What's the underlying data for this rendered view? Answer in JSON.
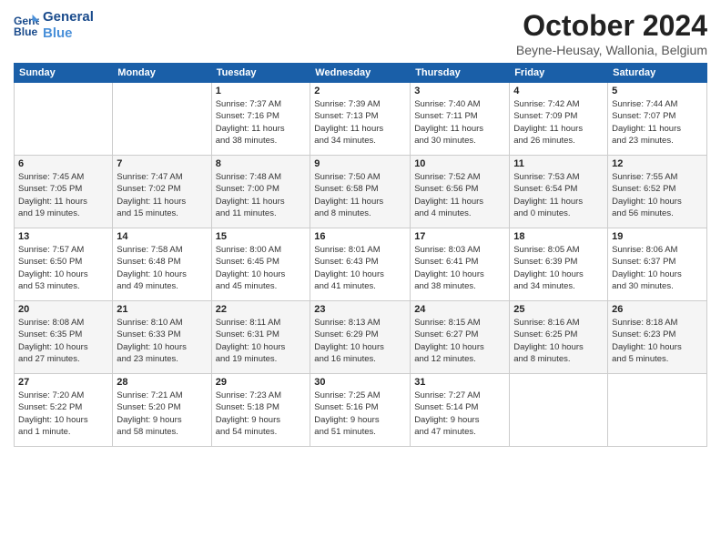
{
  "logo": {
    "line1": "General",
    "line2": "Blue"
  },
  "title": "October 2024",
  "subtitle": "Beyne-Heusay, Wallonia, Belgium",
  "days_of_week": [
    "Sunday",
    "Monday",
    "Tuesday",
    "Wednesday",
    "Thursday",
    "Friday",
    "Saturday"
  ],
  "weeks": [
    [
      {
        "num": "",
        "detail": ""
      },
      {
        "num": "",
        "detail": ""
      },
      {
        "num": "1",
        "detail": "Sunrise: 7:37 AM\nSunset: 7:16 PM\nDaylight: 11 hours\nand 38 minutes."
      },
      {
        "num": "2",
        "detail": "Sunrise: 7:39 AM\nSunset: 7:13 PM\nDaylight: 11 hours\nand 34 minutes."
      },
      {
        "num": "3",
        "detail": "Sunrise: 7:40 AM\nSunset: 7:11 PM\nDaylight: 11 hours\nand 30 minutes."
      },
      {
        "num": "4",
        "detail": "Sunrise: 7:42 AM\nSunset: 7:09 PM\nDaylight: 11 hours\nand 26 minutes."
      },
      {
        "num": "5",
        "detail": "Sunrise: 7:44 AM\nSunset: 7:07 PM\nDaylight: 11 hours\nand 23 minutes."
      }
    ],
    [
      {
        "num": "6",
        "detail": "Sunrise: 7:45 AM\nSunset: 7:05 PM\nDaylight: 11 hours\nand 19 minutes."
      },
      {
        "num": "7",
        "detail": "Sunrise: 7:47 AM\nSunset: 7:02 PM\nDaylight: 11 hours\nand 15 minutes."
      },
      {
        "num": "8",
        "detail": "Sunrise: 7:48 AM\nSunset: 7:00 PM\nDaylight: 11 hours\nand 11 minutes."
      },
      {
        "num": "9",
        "detail": "Sunrise: 7:50 AM\nSunset: 6:58 PM\nDaylight: 11 hours\nand 8 minutes."
      },
      {
        "num": "10",
        "detail": "Sunrise: 7:52 AM\nSunset: 6:56 PM\nDaylight: 11 hours\nand 4 minutes."
      },
      {
        "num": "11",
        "detail": "Sunrise: 7:53 AM\nSunset: 6:54 PM\nDaylight: 11 hours\nand 0 minutes."
      },
      {
        "num": "12",
        "detail": "Sunrise: 7:55 AM\nSunset: 6:52 PM\nDaylight: 10 hours\nand 56 minutes."
      }
    ],
    [
      {
        "num": "13",
        "detail": "Sunrise: 7:57 AM\nSunset: 6:50 PM\nDaylight: 10 hours\nand 53 minutes."
      },
      {
        "num": "14",
        "detail": "Sunrise: 7:58 AM\nSunset: 6:48 PM\nDaylight: 10 hours\nand 49 minutes."
      },
      {
        "num": "15",
        "detail": "Sunrise: 8:00 AM\nSunset: 6:45 PM\nDaylight: 10 hours\nand 45 minutes."
      },
      {
        "num": "16",
        "detail": "Sunrise: 8:01 AM\nSunset: 6:43 PM\nDaylight: 10 hours\nand 41 minutes."
      },
      {
        "num": "17",
        "detail": "Sunrise: 8:03 AM\nSunset: 6:41 PM\nDaylight: 10 hours\nand 38 minutes."
      },
      {
        "num": "18",
        "detail": "Sunrise: 8:05 AM\nSunset: 6:39 PM\nDaylight: 10 hours\nand 34 minutes."
      },
      {
        "num": "19",
        "detail": "Sunrise: 8:06 AM\nSunset: 6:37 PM\nDaylight: 10 hours\nand 30 minutes."
      }
    ],
    [
      {
        "num": "20",
        "detail": "Sunrise: 8:08 AM\nSunset: 6:35 PM\nDaylight: 10 hours\nand 27 minutes."
      },
      {
        "num": "21",
        "detail": "Sunrise: 8:10 AM\nSunset: 6:33 PM\nDaylight: 10 hours\nand 23 minutes."
      },
      {
        "num": "22",
        "detail": "Sunrise: 8:11 AM\nSunset: 6:31 PM\nDaylight: 10 hours\nand 19 minutes."
      },
      {
        "num": "23",
        "detail": "Sunrise: 8:13 AM\nSunset: 6:29 PM\nDaylight: 10 hours\nand 16 minutes."
      },
      {
        "num": "24",
        "detail": "Sunrise: 8:15 AM\nSunset: 6:27 PM\nDaylight: 10 hours\nand 12 minutes."
      },
      {
        "num": "25",
        "detail": "Sunrise: 8:16 AM\nSunset: 6:25 PM\nDaylight: 10 hours\nand 8 minutes."
      },
      {
        "num": "26",
        "detail": "Sunrise: 8:18 AM\nSunset: 6:23 PM\nDaylight: 10 hours\nand 5 minutes."
      }
    ],
    [
      {
        "num": "27",
        "detail": "Sunrise: 7:20 AM\nSunset: 5:22 PM\nDaylight: 10 hours\nand 1 minute."
      },
      {
        "num": "28",
        "detail": "Sunrise: 7:21 AM\nSunset: 5:20 PM\nDaylight: 9 hours\nand 58 minutes."
      },
      {
        "num": "29",
        "detail": "Sunrise: 7:23 AM\nSunset: 5:18 PM\nDaylight: 9 hours\nand 54 minutes."
      },
      {
        "num": "30",
        "detail": "Sunrise: 7:25 AM\nSunset: 5:16 PM\nDaylight: 9 hours\nand 51 minutes."
      },
      {
        "num": "31",
        "detail": "Sunrise: 7:27 AM\nSunset: 5:14 PM\nDaylight: 9 hours\nand 47 minutes."
      },
      {
        "num": "",
        "detail": ""
      },
      {
        "num": "",
        "detail": ""
      }
    ]
  ]
}
